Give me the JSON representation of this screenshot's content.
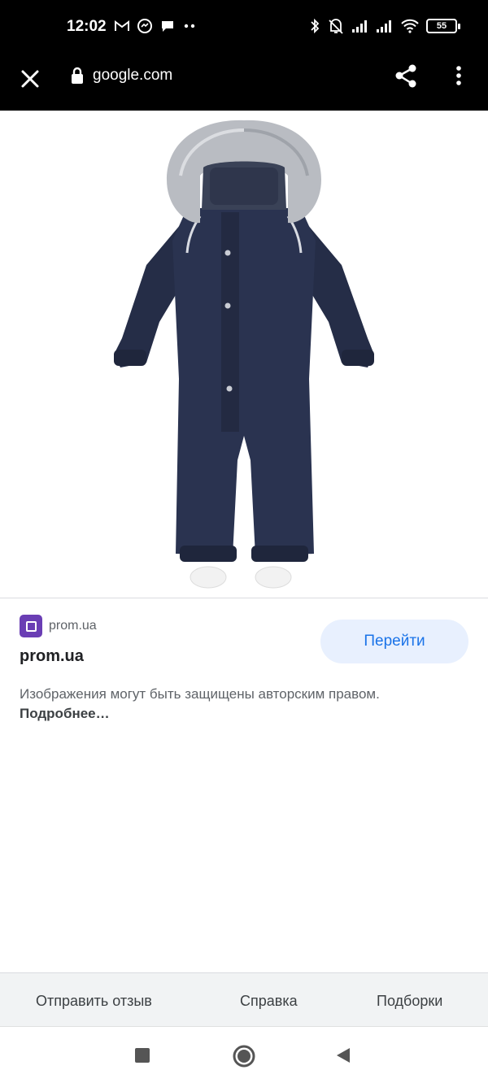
{
  "status_bar": {
    "time": "12:02",
    "battery": "55",
    "left_icons": [
      "gmail-icon",
      "messenger-icon",
      "chat-icon",
      "more-dots-icon"
    ],
    "right_icons": [
      "bluetooth-icon",
      "vibrate-off-icon",
      "signal-icon",
      "signal-icon",
      "wifi-icon",
      "battery-icon"
    ]
  },
  "browser": {
    "url": "google.com",
    "icons": [
      "close-icon",
      "lock-icon",
      "share-icon",
      "more-vert-icon"
    ]
  },
  "result": {
    "source_domain": "prom.ua",
    "title": "prom.ua",
    "visit_label": "Перейти",
    "copyright_text": "Изображения могут быть защищены авторским правом.",
    "more_label": "Подробнее…"
  },
  "footer": {
    "links": [
      "Отправить отзыв",
      "Справка",
      "Подборки"
    ]
  },
  "nav": {
    "icons": [
      "recent-apps-icon",
      "home-icon",
      "back-icon"
    ]
  },
  "colors": {
    "accent": "#1a73e8",
    "button_bg": "#e8f0fe",
    "favicon": "#6a3eb4",
    "jumpsuit": "#2a3350",
    "fur": "#b9bcc2"
  }
}
